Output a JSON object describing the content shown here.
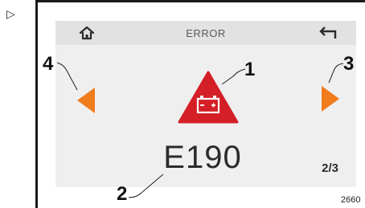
{
  "marker_symbol": "▷",
  "screen": {
    "title": "ERROR",
    "home_icon": "home-icon",
    "back_icon": "back-arrow-icon",
    "prev_icon": "arrow-left-icon",
    "next_icon": "arrow-right-icon",
    "warning_icon": "battery-warning-icon",
    "error_code": "E190",
    "page_indicator": "2/3"
  },
  "callouts": {
    "c1": "1",
    "c2": "2",
    "c3": "3",
    "c4": "4"
  },
  "figure_id": "2660",
  "colors": {
    "accent_orange": "#f07c1e",
    "warning_red": "#d41f26",
    "header_bg": "#e2e2e2",
    "screen_bg": "#efefef"
  }
}
